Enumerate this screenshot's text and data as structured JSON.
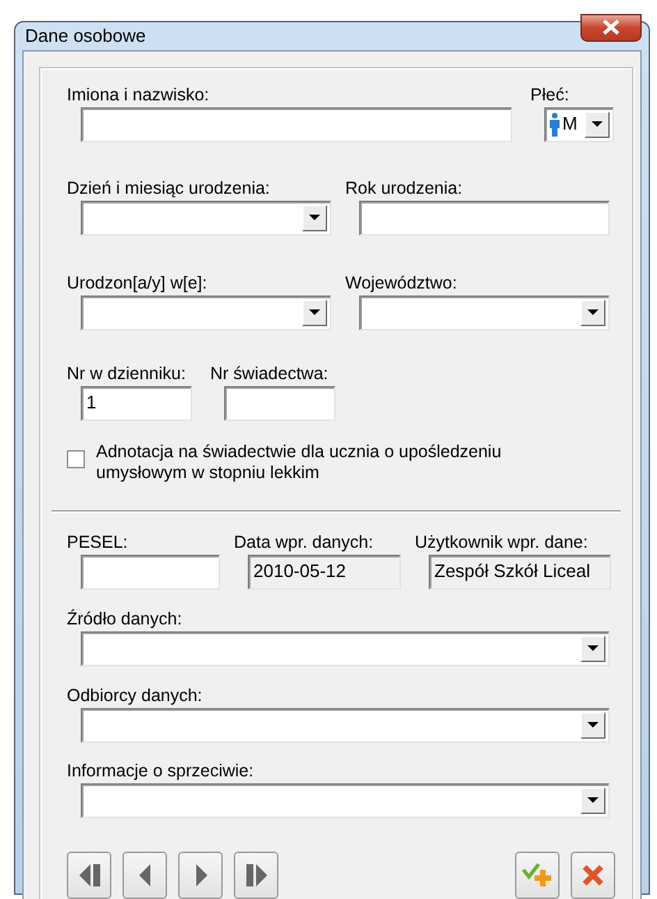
{
  "window": {
    "title": "Dane osobowe"
  },
  "name": {
    "label": "Imiona i nazwisko:"
  },
  "gender": {
    "label": "Płeć:",
    "value": "M"
  },
  "birth_day_month": {
    "label": "Dzień i miesiąc urodzenia:"
  },
  "birth_year": {
    "label": "Rok urodzenia:"
  },
  "birthplace": {
    "label": "Urodzon[a/y] w[e]:"
  },
  "voivodeship": {
    "label": "Województwo:"
  },
  "register_no": {
    "label": "Nr w dzienniku:",
    "value": "1"
  },
  "certificate_no": {
    "label": "Nr świadectwa:"
  },
  "annotation": {
    "label": "Adnotacja na świadectwie dla ucznia o upośledzeniu umysłowym w stopniu lekkim",
    "checked": false
  },
  "pesel": {
    "label": "PESEL:"
  },
  "entry_date": {
    "label": "Data wpr. danych:",
    "value": "2010-05-12"
  },
  "entry_user": {
    "label": "Użytkownik wpr. dane:",
    "value": "Zespół Szkół Liceal"
  },
  "data_source": {
    "label": "Źródło danych:"
  },
  "data_recipients": {
    "label": "Odbiorcy danych:"
  },
  "objection_info": {
    "label": "Informacje o sprzeciwie:"
  },
  "nav_buttons": [
    {
      "kind": "first"
    },
    {
      "kind": "previous"
    },
    {
      "kind": "next"
    },
    {
      "kind": "last"
    }
  ],
  "action_buttons": [
    {
      "kind": "add"
    },
    {
      "kind": "delete"
    }
  ]
}
